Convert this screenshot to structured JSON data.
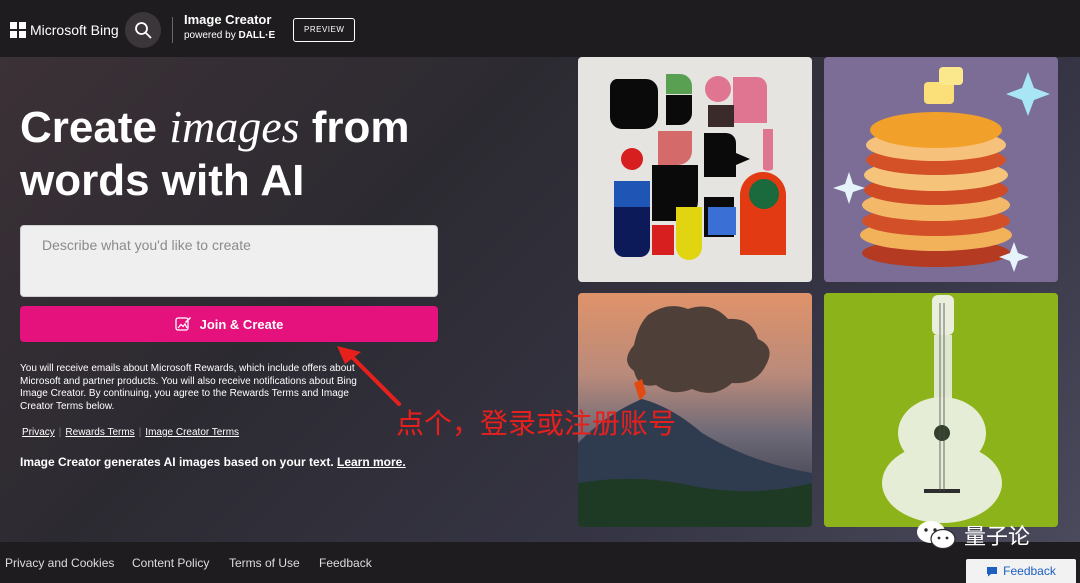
{
  "header": {
    "brand": "Microsoft Bing",
    "app_title": "Image Creator",
    "app_sub_prefix": "powered by ",
    "app_sub_strong": "DALL·E",
    "preview_badge": "PREVIEW"
  },
  "hero": {
    "headline_1": "Create ",
    "headline_em": "images",
    "headline_2": " from",
    "headline_3": "words with AI"
  },
  "prompt": {
    "placeholder": "Describe what you'd like to create",
    "value": ""
  },
  "join_button": {
    "label": "Join & Create"
  },
  "notice": "You will receive emails about Microsoft Rewards, which include offers about Microsoft and partner products. You will also receive notifications about Bing Image Creator. By continuing, you agree to the Rewards Terms and Image Creator Terms below.",
  "links": {
    "privacy": "Privacy",
    "rewards_terms": "Rewards Terms",
    "image_creator_terms": "Image Creator Terms",
    "separator": "|"
  },
  "gen_note": {
    "text": "Image Creator generates AI images based on your text. ",
    "learn_more": "Learn more."
  },
  "annotation": {
    "text": "点个，登录或注册账号",
    "color": "#e8201d"
  },
  "footer": {
    "privacy_cookies": "Privacy and Cookies",
    "content_policy": "Content Policy",
    "terms_of_use": "Terms of Use",
    "feedback": "Feedback"
  },
  "feedback_button": {
    "label": "Feedback"
  },
  "watermark": {
    "text": "量子论"
  },
  "colors": {
    "accent": "#e5117d",
    "header_bg": "#1f1c1f",
    "annotation": "#e8201d"
  }
}
